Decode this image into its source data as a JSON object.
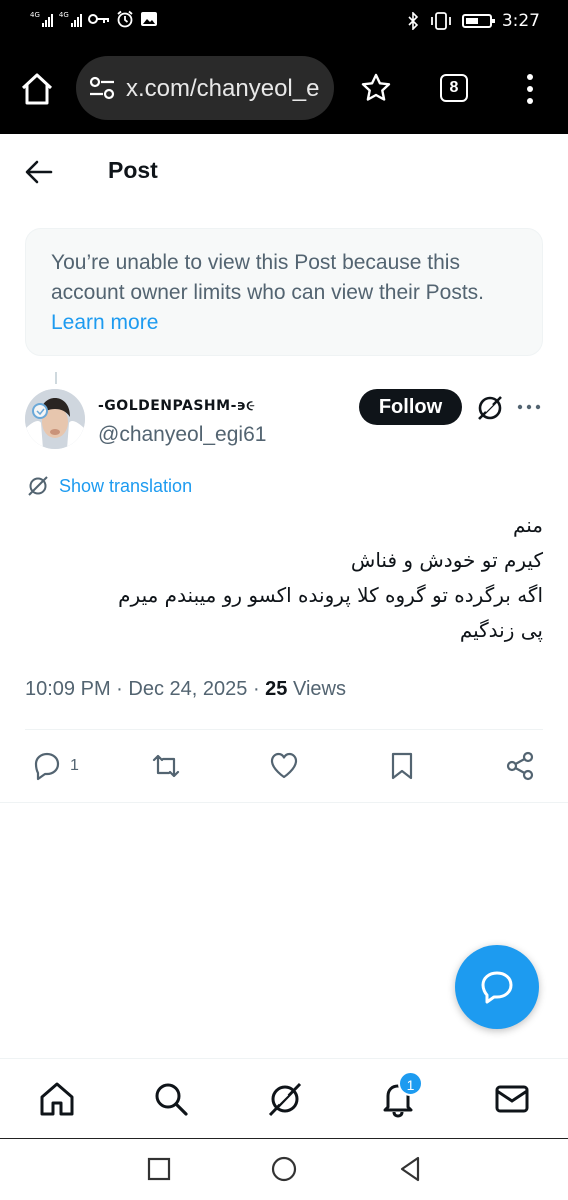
{
  "status_bar": {
    "signal1_tag": "4G",
    "signal2_tag": "4G",
    "time": "3:27"
  },
  "browser": {
    "url": "x.com/chanyeol_e",
    "tab_count": "8"
  },
  "header": {
    "title": "Post"
  },
  "notice": {
    "text": "You’re unable to view this Post because this account owner limits who can view their Posts.",
    "link": "Learn more"
  },
  "author": {
    "display_name": "-GOLDENPASHM-϶૯",
    "handle": "@chanyeol_egi61",
    "follow_label": "Follow"
  },
  "translation": {
    "label": "Show translation"
  },
  "post": {
    "lines": [
      "منم",
      "کیرم تو خودش و فناش",
      "اگه برگرده تو گروه کلا پرونده اکسو رو میبندم میرم",
      "پی زندگیم"
    ],
    "time": "10:09 PM",
    "date": "Dec 24, 2025",
    "views_count": "25",
    "views_label": "Views"
  },
  "actions": {
    "reply_count": "1"
  },
  "bottom_nav": {
    "notification_badge": "1"
  },
  "colors": {
    "accent": "#1d9bf0",
    "text_primary": "#0f1419",
    "text_secondary": "#536471",
    "notice_bg": "#f7f9f9"
  },
  "icons": [
    "home-icon",
    "settings-tune-icon",
    "star-icon",
    "tabs-icon",
    "more-vert-icon",
    "back-arrow-icon",
    "grok-icon",
    "more-horiz-icon",
    "reply-icon",
    "repost-icon",
    "like-icon",
    "bookmark-icon",
    "share-icon",
    "compose-message-icon",
    "search-icon",
    "notifications-icon",
    "mail-icon"
  ]
}
